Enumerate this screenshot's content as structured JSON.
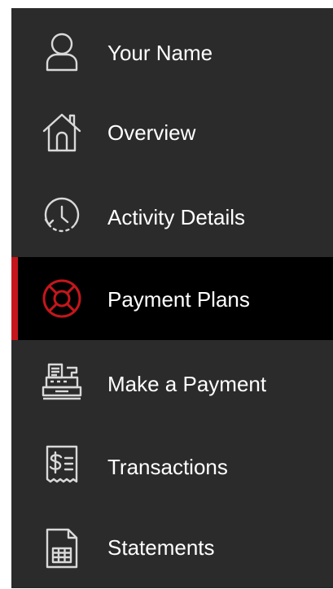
{
  "colors": {
    "sidebar_bg": "#2b2b2b",
    "active_bg": "#000000",
    "accent": "#c4161c",
    "text": "#ffffff",
    "icon": "#d9d9d9"
  },
  "nav": {
    "items": [
      {
        "id": "profile",
        "label": "Your Name",
        "icon": "user-icon",
        "active": false
      },
      {
        "id": "overview",
        "label": "Overview",
        "icon": "home-icon",
        "active": false
      },
      {
        "id": "activity-details",
        "label": "Activity Details",
        "icon": "clock-history-icon",
        "active": false
      },
      {
        "id": "payment-plans",
        "label": "Payment Plans",
        "icon": "lifebuoy-icon",
        "active": true
      },
      {
        "id": "make-a-payment",
        "label": "Make a Payment",
        "icon": "cash-register-icon",
        "active": false
      },
      {
        "id": "transactions",
        "label": "Transactions",
        "icon": "receipt-icon",
        "active": false
      },
      {
        "id": "statements",
        "label": "Statements",
        "icon": "spreadsheet-document-icon",
        "active": false
      }
    ]
  }
}
